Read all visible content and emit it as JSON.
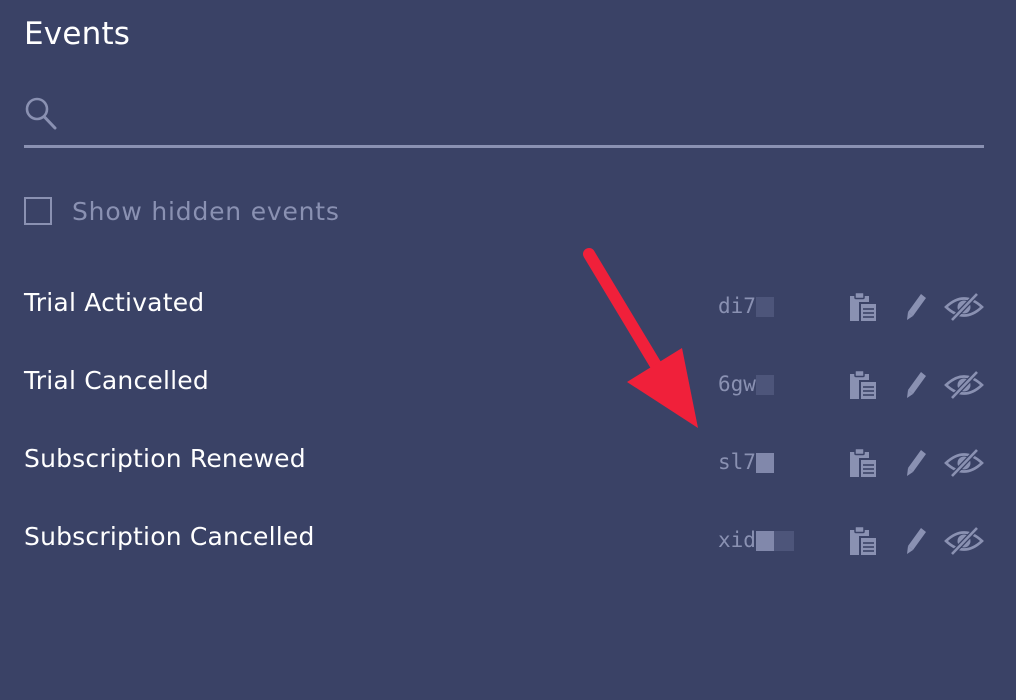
{
  "panel": {
    "title": "Events"
  },
  "search": {
    "icon": "search-icon",
    "placeholder": "",
    "value": ""
  },
  "filter": {
    "show_hidden_label": "Show hidden events",
    "show_hidden_checked": false
  },
  "events": [
    {
      "name": "Trial Activated",
      "id_visible": "di7"
    },
    {
      "name": "Trial Cancelled",
      "id_visible": "6gw"
    },
    {
      "name": "Subscription Renewed",
      "id_visible": "sl7"
    },
    {
      "name": "Subscription Cancelled",
      "id_visible": "xid"
    }
  ],
  "row_actions": [
    "clipboard-icon",
    "pencil-icon",
    "eye-slash-icon"
  ],
  "annotation": {
    "type": "arrow",
    "color": "#f0203a"
  },
  "colors": {
    "background": "#3a4266",
    "muted": "#8a91b2",
    "text": "#ffffff",
    "arrow": "#f0203a"
  }
}
